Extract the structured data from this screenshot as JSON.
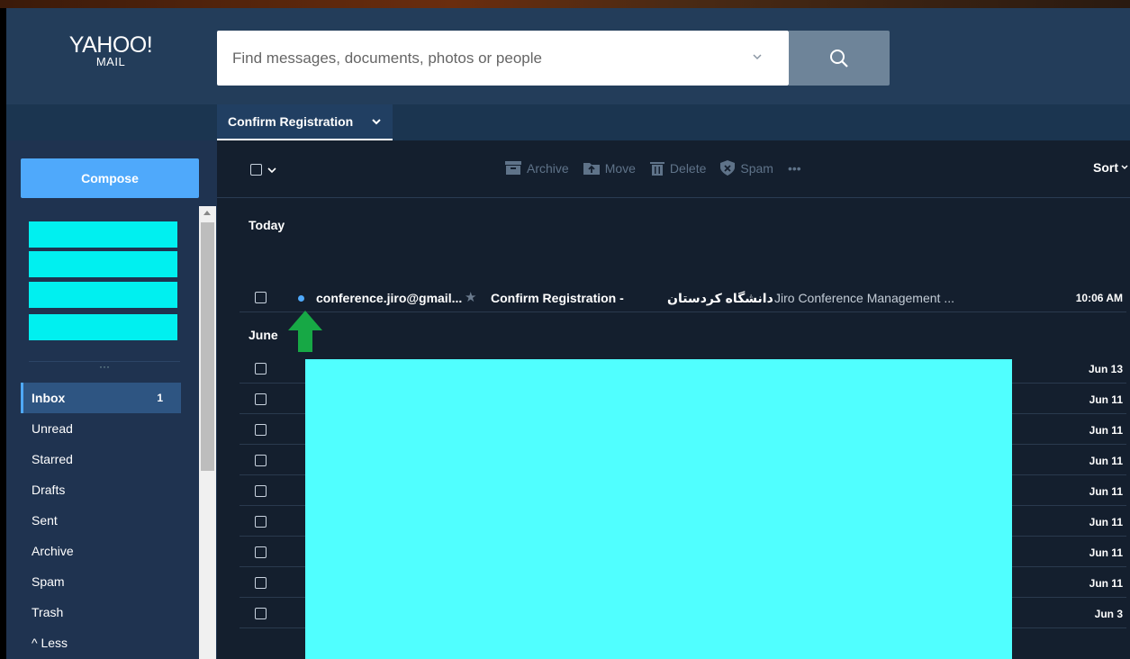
{
  "logo": {
    "brand": "YAHOO!",
    "product": "MAIL"
  },
  "search": {
    "placeholder": "Find messages, documents, photos or people"
  },
  "tab": {
    "label": "Confirm Registration"
  },
  "sidebar": {
    "compose_label": "Compose",
    "more_dots": "···",
    "folders": [
      {
        "label": "Inbox",
        "count": "1",
        "active": true
      },
      {
        "label": "Unread"
      },
      {
        "label": "Starred"
      },
      {
        "label": "Drafts"
      },
      {
        "label": "Sent"
      },
      {
        "label": "Archive"
      },
      {
        "label": "Spam"
      },
      {
        "label": "Trash"
      },
      {
        "label": "^ Less"
      }
    ]
  },
  "toolbar": {
    "archive": "Archive",
    "move": "Move",
    "delete": "Delete",
    "spam": "Spam",
    "more": "•••",
    "sort": "Sort"
  },
  "messages": {
    "today_header": "Today",
    "june_header": "June",
    "featured": {
      "sender": "conference.jiro@gmail...",
      "subject": "Confirm Registration -",
      "subject_fa": "دانشگاه کردستان",
      "preview": "Jiro Conference Management ...",
      "time": "10:06 AM",
      "unread": true
    },
    "dates": [
      "Jun 13",
      "Jun 11",
      "Jun 11",
      "Jun 11",
      "Jun 11",
      "Jun 11",
      "Jun 11",
      "Jun 11",
      "Jun 3"
    ]
  },
  "colors": {
    "accent": "#4fa9fb",
    "redaction": "#00f0f0",
    "arrow": "#17a845"
  }
}
